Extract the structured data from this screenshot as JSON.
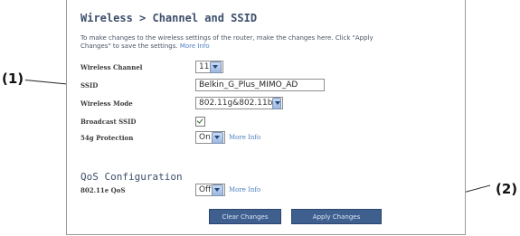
{
  "callouts": {
    "one": "(1)",
    "two": "(2)"
  },
  "breadcrumb": "Wireless > Channel and SSID",
  "intro": {
    "line1": "To make changes to the wireless settings of the router, make the changes here. Click \"Apply",
    "line2_prefix": "Changes\" to save the settings.",
    "more_info": "More Info"
  },
  "fields": {
    "wireless_channel": {
      "label": "Wireless Channel",
      "value": "11"
    },
    "ssid": {
      "label": "SSID",
      "value": "Belkin_G_Plus_MIMO_AD"
    },
    "wireless_mode": {
      "label": "Wireless Mode",
      "value": "802.11g&802.11b"
    },
    "broadcast_ssid": {
      "label": "Broadcast SSID",
      "checked": true
    },
    "protection_54g": {
      "label": "54g Protection",
      "value": "On",
      "more_info": "More Info"
    }
  },
  "qos": {
    "title": "QoS Configuration",
    "label": "802.11e QoS",
    "value": "Off",
    "more_info": "More Info"
  },
  "buttons": {
    "clear": "Clear Changes",
    "apply": "Apply Changes"
  }
}
